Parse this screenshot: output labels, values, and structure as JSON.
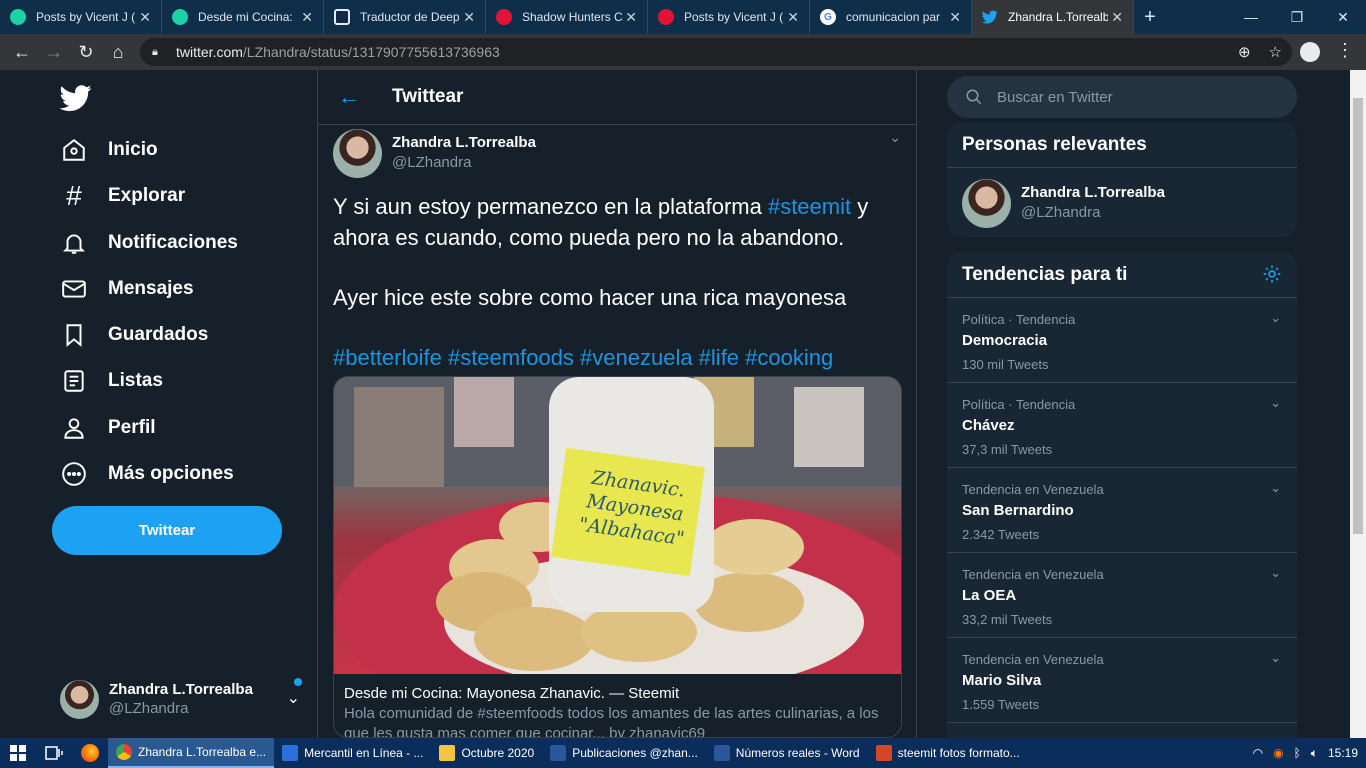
{
  "browser": {
    "tabs": [
      {
        "label": "Posts by Vicent J (",
        "icon": "steemit-icon",
        "color": "#1bd1a5"
      },
      {
        "label": "Desde mi Cocina: ",
        "icon": "steemit-icon",
        "color": "#1bd1a5"
      },
      {
        "label": "Traductor de Deep",
        "icon": "deepl-icon",
        "color": "#0f2b46"
      },
      {
        "label": "Shadow Hunters C",
        "icon": "hive-icon",
        "color": "#e31337"
      },
      {
        "label": "Posts by Vicent J (",
        "icon": "hive-icon",
        "color": "#e31337"
      },
      {
        "label": "comunicacion par",
        "icon": "google-icon",
        "color": "#ffffff"
      },
      {
        "label": "Zhandra L.Torrealb",
        "icon": "twitter-icon",
        "color": "#1da1f2",
        "active": true
      }
    ],
    "url_host": "twitter.com",
    "url_path": "/LZhandra/status/1317907755613736963"
  },
  "nav": {
    "items": [
      {
        "label": "Inicio",
        "icon": "home-icon"
      },
      {
        "label": "Explorar",
        "icon": "hashtag-icon"
      },
      {
        "label": "Notificaciones",
        "icon": "bell-icon"
      },
      {
        "label": "Mensajes",
        "icon": "mail-icon"
      },
      {
        "label": "Guardados",
        "icon": "bookmark-icon"
      },
      {
        "label": "Listas",
        "icon": "list-icon"
      },
      {
        "label": "Perfil",
        "icon": "person-icon"
      },
      {
        "label": "Más opciones",
        "icon": "more-icon"
      }
    ],
    "tweet_button": "Twittear",
    "account": {
      "name": "Zhandra L.Torrealba",
      "handle": "@LZhandra"
    }
  },
  "main": {
    "title": "Twittear",
    "tweet": {
      "author_name": "Zhandra L.Torrealba",
      "author_handle": "@LZhandra",
      "line1_pre": "Y si aun estoy permanezco en la plataforma ",
      "line1_tag": "#steemit",
      "line1_post": " y ahora  es cuando, como pueda pero no la abandono.",
      "line2": "Ayer hice este sobre como hacer una rica mayonesa",
      "hashtags": "#betterloife #steemfoods #venezuela #life #cooking"
    },
    "card": {
      "title": "Desde mi Cocina: Mayonesa Zhanavic. — Steemit",
      "description": "Hola comunidad de #steemfoods todos los amantes de las artes culinarias, a los que les gusta mas comer que cocinar... by zhanavic69",
      "jar_label_line1": "Zhanavic.",
      "jar_label_line2": "Mayonesa",
      "jar_label_line3": "\"Albahaca\""
    }
  },
  "right": {
    "search_placeholder": "Buscar en Twitter",
    "relevant_title": "Personas relevantes",
    "relevant_person": {
      "name": "Zhandra L.Torrealba",
      "handle": "@LZhandra"
    },
    "trends_title": "Tendencias para ti",
    "trends": [
      {
        "context": "Política · Tendencia",
        "name": "Democracia",
        "count": "130 mil Tweets"
      },
      {
        "context": "Política · Tendencia",
        "name": "Chávez",
        "count": "37,3 mil Tweets"
      },
      {
        "context": "Tendencia en Venezuela",
        "name": "San Bernardino",
        "count": "2.342 Tweets"
      },
      {
        "context": "Tendencia en Venezuela",
        "name": "La OEA",
        "count": "33,2 mil Tweets"
      },
      {
        "context": "Tendencia en Venezuela",
        "name": "Mario Silva",
        "count": "1.559 Tweets"
      }
    ]
  },
  "taskbar": {
    "apps": [
      {
        "label": "Zhandra L.Torrealba e...",
        "icon": "chrome-icon",
        "active": true
      },
      {
        "label": "Mercantil en Línea - ...",
        "icon": "window-icon"
      },
      {
        "label": "Octubre 2020",
        "icon": "folder-icon"
      },
      {
        "label": "Publicaciones @zhan...",
        "icon": "word-icon"
      },
      {
        "label": "Números reales - Word",
        "icon": "word-icon"
      },
      {
        "label": "steemit fotos formato...",
        "icon": "powerpoint-icon"
      }
    ],
    "clock": "15:19"
  },
  "colors": {
    "accent": "#1da1f2",
    "background": "#15202b",
    "panel": "#192734",
    "border": "#38444d",
    "muted": "#8899a6"
  }
}
